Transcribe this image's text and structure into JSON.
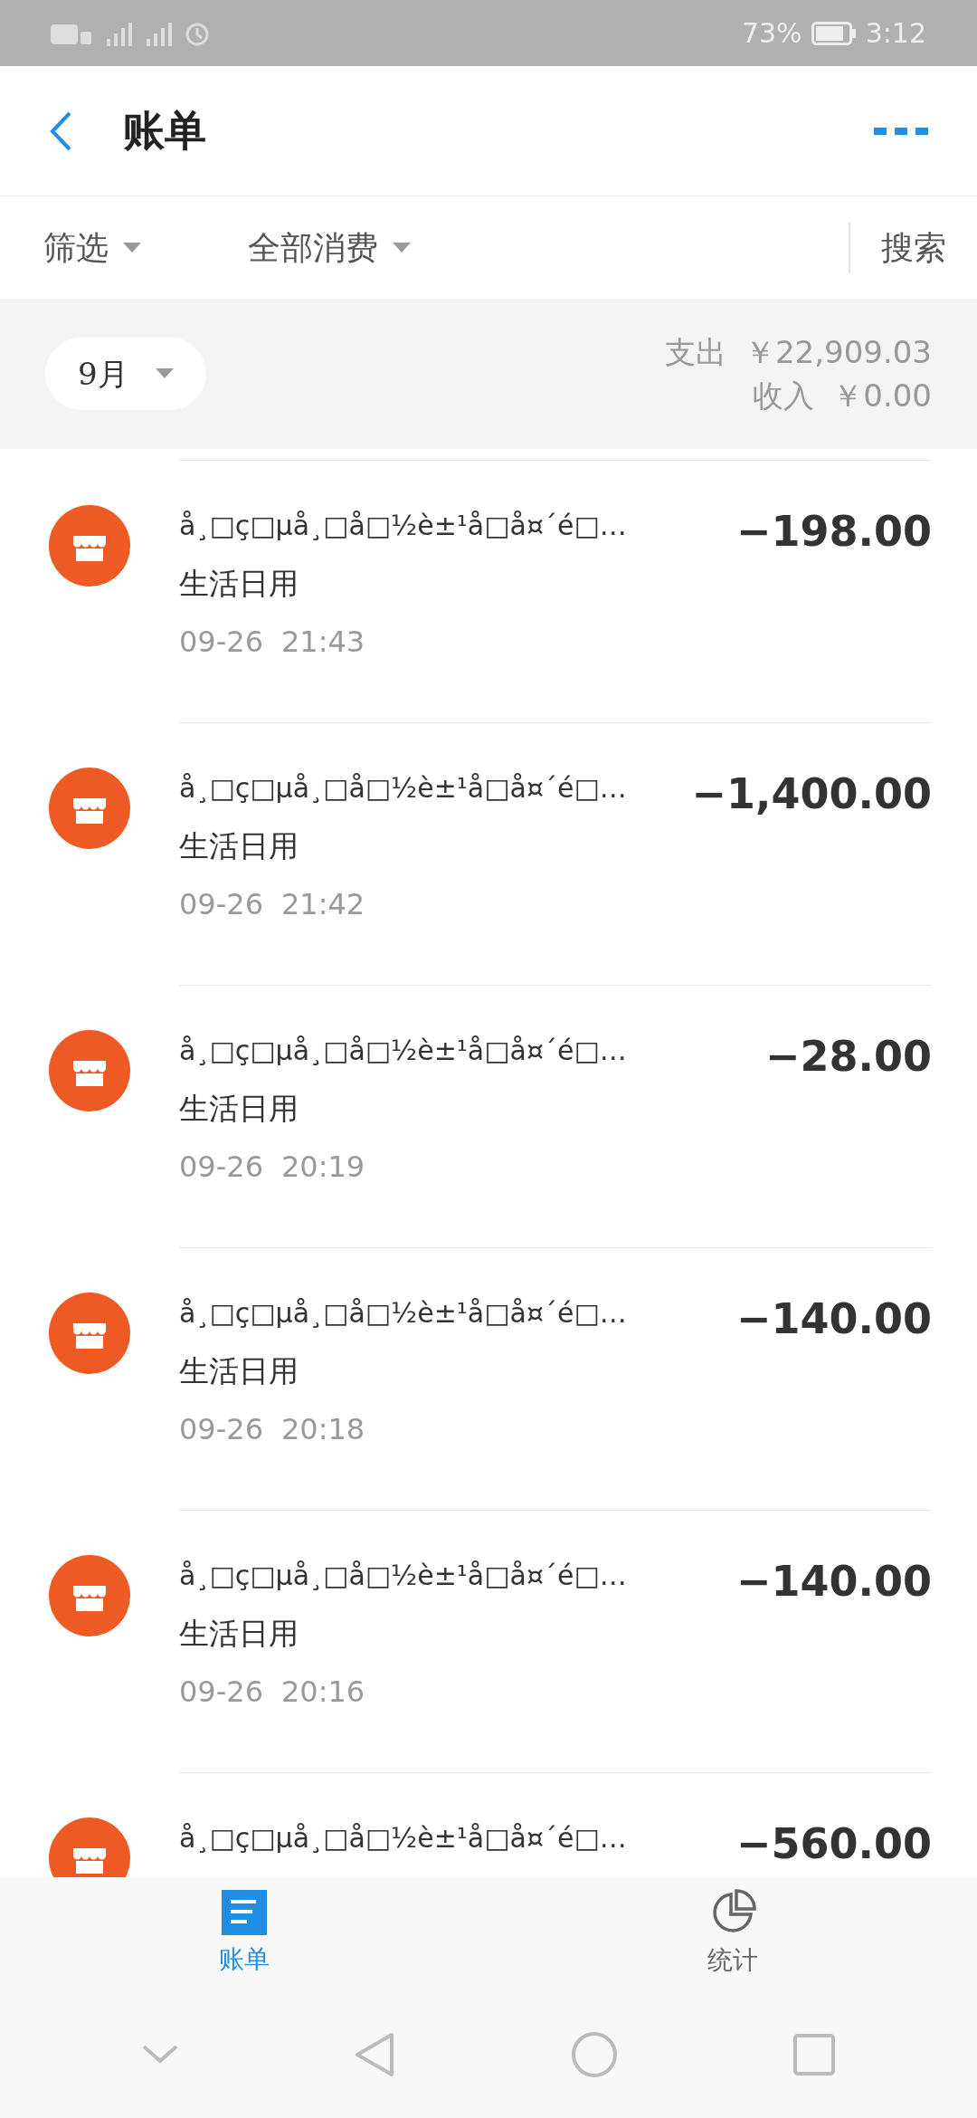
{
  "status_bar": {
    "battery": "73%",
    "time": "3:12"
  },
  "header": {
    "title": "账单"
  },
  "filter_bar": {
    "filter": "筛选",
    "category": "全部消费",
    "search": "搜索"
  },
  "summary": {
    "month": "9月",
    "expense_label": "支出",
    "expense": "￥22,909.03",
    "income_label": "收入",
    "income": "￥0.00"
  },
  "transactions": [
    {
      "title": "å¸□ç□µå¸□å□½è±¹å□å¤´é□…",
      "category": "生活日用",
      "date": "09-26",
      "time": "21:43",
      "amount": "−198.00"
    },
    {
      "title": "å¸□ç□µå¸□å□½è±¹å□å¤´é□…",
      "category": "生活日用",
      "date": "09-26",
      "time": "21:42",
      "amount": "−1,400.00"
    },
    {
      "title": "å¸□ç□µå¸□å□½è±¹å□å¤´é□…",
      "category": "生活日用",
      "date": "09-26",
      "time": "20:19",
      "amount": "−28.00"
    },
    {
      "title": "å¸□ç□µå¸□å□½è±¹å□å¤´é□…",
      "category": "生活日用",
      "date": "09-26",
      "time": "20:18",
      "amount": "−140.00"
    },
    {
      "title": "å¸□ç□µå¸□å□½è±¹å□å¤´é□…",
      "category": "生活日用",
      "date": "09-26",
      "time": "20:16",
      "amount": "−140.00"
    },
    {
      "title": "å¸□ç□µå¸□å□½è±¹å□å¤´é□…",
      "amount": "−560.00"
    }
  ],
  "tabs": [
    {
      "label": "账单",
      "kind": "list",
      "selected": true
    },
    {
      "label": "统计",
      "kind": "pie",
      "selected": false
    }
  ]
}
